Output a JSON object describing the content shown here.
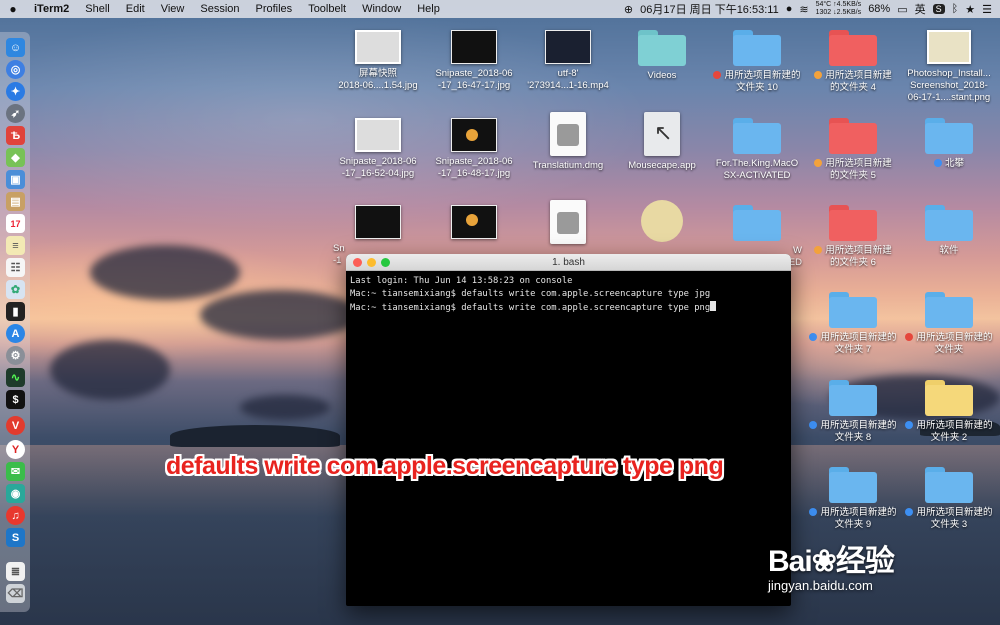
{
  "menubar": {
    "apple": "",
    "app": "iTerm2",
    "items": [
      "Shell",
      "Edit",
      "View",
      "Session",
      "Profiles",
      "Toolbelt",
      "Window",
      "Help"
    ],
    "clock": "06月17日 周日 下午16:53:11",
    "temp": "54°C",
    "net_up": "↑4.5KB/s",
    "rpm": "1302",
    "net_down": "↓2.5KB/s",
    "battery": "68%",
    "ime": "英"
  },
  "desktop": {
    "row1": [
      {
        "l1": "屏幕快照",
        "l2": "2018-06....1.54.jpg"
      },
      {
        "l1": "Snipaste_2018-06",
        "l2": "-17_16-47-17.jpg"
      },
      {
        "l1": "utf-8'",
        "l2": "'273914...1-16.mp4"
      },
      {
        "l1": "Videos",
        "l2": ""
      },
      {
        "l1": "用所选项目新建的",
        "l2": "文件夹 10"
      },
      {
        "l1": "用所选项目新建",
        "l2": "的文件夹 4"
      },
      {
        "l1": "Photoshop_Install...",
        "l2": "Screenshot_2018-"
      },
      {
        "l1": "",
        "l2": "06-17-1....stant.png"
      }
    ],
    "row2": [
      {
        "l1": "Snipaste_2018-06",
        "l2": "-17_16-52-04.jpg"
      },
      {
        "l1": "Snipaste_2018-06",
        "l2": "-17_16-48-17.jpg"
      },
      {
        "l1": "Translatium.dmg",
        "l2": ""
      },
      {
        "l1": "Mousecape.app",
        "l2": ""
      },
      {
        "l1": "For.The.King.MacO",
        "l2": "SX-ACTiVATED"
      },
      {
        "l1": "用所选项目新建",
        "l2": "的文件夹 5"
      },
      {
        "l1": "北攀",
        "l2": ""
      }
    ],
    "row3": [
      {
        "l1": "Sn",
        "l2": "-1"
      },
      {
        "l1": "",
        "l2": ""
      },
      {
        "l1": "",
        "l2": ""
      },
      {
        "l1": "",
        "l2": ""
      },
      {
        "l1": "W",
        "l2": "ED"
      },
      {
        "l1": "用所选项目新建",
        "l2": "的文件夹 6"
      },
      {
        "l1": "软件",
        "l2": ""
      }
    ],
    "right_folders": [
      {
        "l1": "用所选项目新建的",
        "l2": "文件夹 7"
      },
      {
        "l1": "用所选项目新建的",
        "l2": "文件夹"
      },
      {
        "l1": "用所选项目新建的",
        "l2": "文件夹 8"
      },
      {
        "l1": "用所选项目新建的",
        "l2": "文件夹 2"
      },
      {
        "l1": "用所选项目新建的",
        "l2": "文件夹 9"
      },
      {
        "l1": "用所选项目新建的",
        "l2": "文件夹 3"
      }
    ]
  },
  "terminal": {
    "title": "1. bash",
    "lines": [
      "Last login: Thu Jun 14 13:58:23 on console",
      "Mac:~ tiansemixiang$ defaults write com.apple.screencapture type jpg",
      "Mac:~ tiansemixiang$ defaults write com.apple.screencapture type png"
    ]
  },
  "caption": "defaults write com.apple.screencapture type png",
  "watermark": {
    "brand": "Bai",
    "brand2": "经验",
    "url": "jingyan.baidu.com"
  },
  "colors": {
    "red_tag": "#e5473c",
    "orange_tag": "#f3a23b",
    "blue_tag": "#3d8ff2",
    "folder_blue": "#6ab6ef",
    "folder_red": "#f06060",
    "folder_yellow": "#f5d87a"
  }
}
